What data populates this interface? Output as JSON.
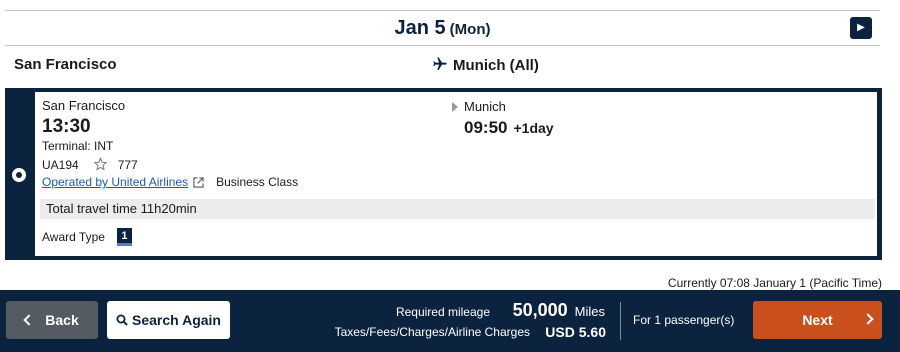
{
  "date_header": {
    "date": "Jan 5",
    "day": "(Mon)",
    "next_icon": "chevron-right-icon"
  },
  "route": {
    "origin": "San Francisco",
    "destination": "Munich (All)",
    "plane_icon": "airplane-icon"
  },
  "flight": {
    "departure_city": "San Francisco",
    "departure_time": "13:30",
    "terminal": "Terminal: INT",
    "flight_number": "UA194",
    "aircraft": "777",
    "operated_by": "Operated by United Airlines",
    "cabin": "Business Class",
    "arrival_city": "Munich",
    "arrival_time": "09:50",
    "arrival_day_offset": "+1day",
    "total_travel_time": "Total travel time 11h20min",
    "award_type_label": "Award Type",
    "award_type_value": "1"
  },
  "current_time": "Currently 07:08 January 1 (Pacific Time)",
  "footer": {
    "back_label": "Back",
    "search_again_label": "Search Again",
    "mileage_label": "Required mileage",
    "mileage_value": "50,000",
    "mileage_unit": "Miles",
    "taxes_label": "Taxes/Fees/Charges/Airline Charges",
    "taxes_value": "USD  5.60",
    "passengers": "For 1 passenger(s)",
    "next_label": "Next"
  },
  "colors": {
    "navy": "#0c2340",
    "orange": "#c9501d",
    "gray_button": "#555b63",
    "link": "#1a5bb5"
  }
}
